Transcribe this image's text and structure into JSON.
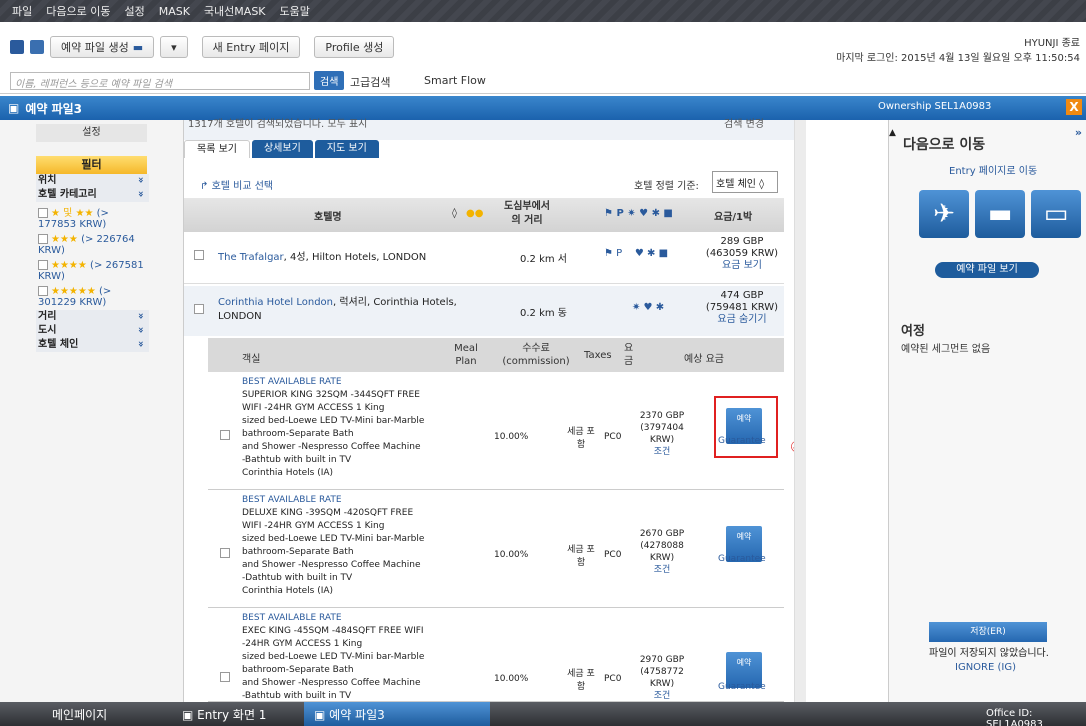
{
  "menu": [
    "파일",
    "다음으로 이동",
    "설정",
    "MASK",
    "국내선MASK",
    "도움말"
  ],
  "toolbar": {
    "make_pnr": "예약 파일 생성",
    "new_entry": "새 Entry 페이지",
    "profile": "Profile 생성",
    "search_placeholder": "이름, 레퍼런스 등으로 예약 파일 검색",
    "search_btn": "검색",
    "adv_search": "고급검색",
    "smart_flow": "Smart Flow"
  },
  "user": {
    "name": "HYUNJI 종료",
    "last_login": "마지막 로그인: 2015년 4월 13일 월요일 오후 11:50:54"
  },
  "titlebar": {
    "title": "예약 파일3",
    "ownership": "Ownership SEL1A0983",
    "close": "X"
  },
  "left": {
    "settings": "설정",
    "filter": "필터",
    "sections": {
      "location": "위치",
      "category": "호텔 카테고리",
      "distance": "거리",
      "city": "도시",
      "chain": "호텔 체인"
    },
    "cats": [
      {
        "stars": "★ 및 ★★",
        "label": "(> 177853 KRW)"
      },
      {
        "stars": "★★★",
        "label": "(> 226764 KRW)"
      },
      {
        "stars": "★★★★",
        "label": "(> 267581 KRW)"
      },
      {
        "stars": "★★★★★",
        "label": "(> 301229 KRW)"
      }
    ]
  },
  "main": {
    "topstrip": "1317개 호텔이 검색되었습니다. 모두 표시",
    "topstrip_right": "검색 변경",
    "tabs": [
      "목록 보기",
      "상세보기",
      "지도 보기"
    ],
    "compare": "호텔 비교 선택",
    "sort_label": "호텔 정렬 기준:",
    "sort_value": "호텔 체인 ◊",
    "headers": {
      "name": "호텔명",
      "distance": "도심부에서 의 거리",
      "price": "요금/1박"
    },
    "hotels": [
      {
        "name": "The Trafalgar",
        "rest": ", 4성, Hilton Hotels, LONDON",
        "dist": "0.2 km 서",
        "p1": "289 GBP",
        "p2": "(463059 KRW)",
        "link": "요금 보기"
      },
      {
        "name": "Corinthia Hotel London",
        "rest": ", 럭셔리, Corinthia Hotels, LONDON",
        "dist": "0.2 km 동",
        "p1": "474 GBP",
        "p2": "(759481 KRW)",
        "link": "요금 숨기기"
      }
    ],
    "sub": {
      "room": "객실",
      "meal": "Meal Plan",
      "comm": "수수료 (commission)",
      "taxes": "Taxes",
      "fee": "요금",
      "est": "예상 요금"
    },
    "rates": [
      {
        "tag": "BEST AVAILABLE RATE",
        "desc": [
          "SUPERIOR KING 32SQM -344SQFT FREE",
          "WIFI -24HR GYM ACCESS 1 King",
          "sized bed-Loewe LED TV-Mini bar-Marble",
          "bathroom-Separate Bath",
          "and Shower -Nespresso Coffee Machine",
          "-Bathtub with built in TV",
          "Corinthia Hotels (IA)"
        ],
        "comm": "10.00%",
        "tax": "세금 포함",
        "pc": "PC0",
        "p1": "2370 GBP",
        "p2": "(3797404",
        "p3": "KRW)",
        "cond": "조건",
        "book": "예약",
        "guar": "Guarantee"
      },
      {
        "tag": "BEST AVAILABLE RATE",
        "desc": [
          "DELUXE KING -39SQM -420SQFT FREE",
          "WIFI -24HR GYM ACCESS 1 King",
          "sized bed-Loewe LED TV-Mini bar-Marble",
          "bathroom-Separate Bath",
          "and Shower -Nespresso Coffee Machine",
          "-Dathtub with built in TV",
          "Corinthia Hotels (IA)"
        ],
        "comm": "10.00%",
        "tax": "세금 포함",
        "pc": "PC0",
        "p1": "2670 GBP",
        "p2": "(4278088",
        "p3": "KRW)",
        "cond": "조건",
        "book": "예약",
        "guar": "Guarantee"
      },
      {
        "tag": "BEST AVAILABLE RATE",
        "desc": [
          "EXEC KING -45SQM -484SQFT FREE WIFI",
          "-24HR GYM ACCESS 1 King",
          "sized bed-Loewe LED TV-Mini bar-Marble",
          "bathroom-Separate Bath",
          "and Shower -Nespresso Coffee Machine",
          "-Bathtub with built in TV"
        ],
        "comm": "10.00%",
        "tax": "세금 포함",
        "pc": "PC0",
        "p1": "2970 GBP",
        "p2": "(4758772",
        "p3": "KRW)",
        "cond": "조건",
        "book": "예약",
        "guar": "Guarantee"
      }
    ]
  },
  "right": {
    "title": "다음으로 이동",
    "sub": "Entry 페이지로 이동",
    "view_file": "예약 파일 보기",
    "itinerary": "여정",
    "itinerary_empty": "예약된 세그먼트 없음",
    "save": "저장(ER)",
    "not_saved": "파일이 저장되지 않았습니다.",
    "ignore": "IGNORE (IG)"
  },
  "annotation": "④",
  "taskbar": {
    "main": "메인페이지",
    "entry": "Entry 화면 1",
    "pnr": "예약 파일3",
    "office": "Office ID: SEL1A0983"
  }
}
